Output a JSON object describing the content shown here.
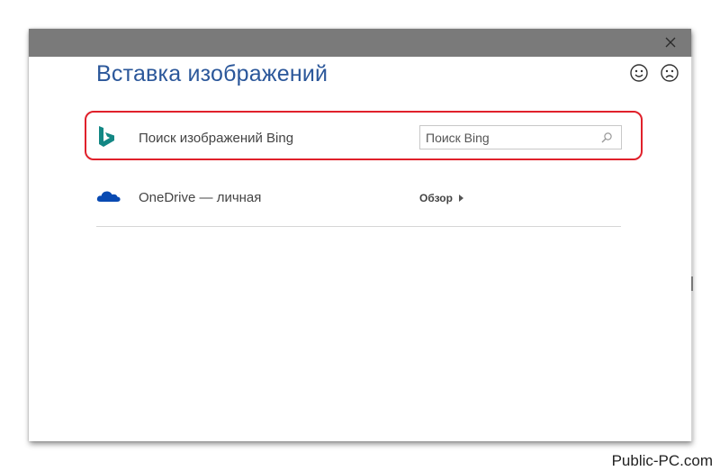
{
  "dialog": {
    "title": "Вставка изображений",
    "close_icon": "close-icon",
    "feedback": {
      "smile_icon": "smile-icon",
      "frown_icon": "frown-icon"
    }
  },
  "sources": [
    {
      "icon": "bing-icon",
      "label": "Поиск изображений Bing",
      "search_placeholder": "Поиск Bing",
      "search_icon": "search-icon"
    },
    {
      "icon": "onedrive-icon",
      "label": "OneDrive — личная",
      "action_label": "Обзор"
    }
  ],
  "watermark": "Public-PC.com",
  "colors": {
    "title": "#2b579a",
    "titlebar": "#7a7a7a",
    "bing": "#138784",
    "onedrive": "#094ab2",
    "highlight": "#e0212b"
  }
}
